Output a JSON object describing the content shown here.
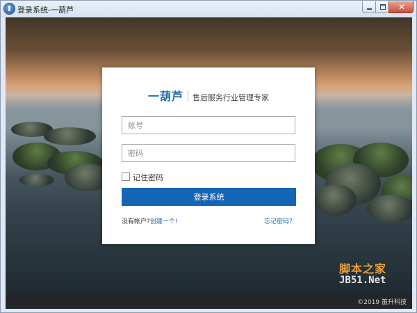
{
  "window": {
    "title": "登录系统-一葫芦",
    "controls": {
      "minimize": "minimize",
      "maximize": "maximize",
      "close": "✕"
    }
  },
  "login": {
    "logo": "一葫芦",
    "slogan": "售后服务行业管理专家",
    "username_placeholder": "账号",
    "password_placeholder": "密码",
    "username_value": "",
    "password_value": "",
    "remember_label": "记住密码",
    "remember_checked": false,
    "submit_label": "登录系统",
    "no_account_text": "没有帐户?",
    "create_link": "创建一个!",
    "forgot_link": "忘记密码？"
  },
  "footer": {
    "copyright": "©2019 笛升科技"
  },
  "watermark": {
    "line1": "脚本之家",
    "line2": "JB51.Net"
  },
  "colors": {
    "accent": "#1565b5",
    "brand": "#1d6bb6",
    "footer_bg": "#222629",
    "watermark": "#e8a03a"
  }
}
